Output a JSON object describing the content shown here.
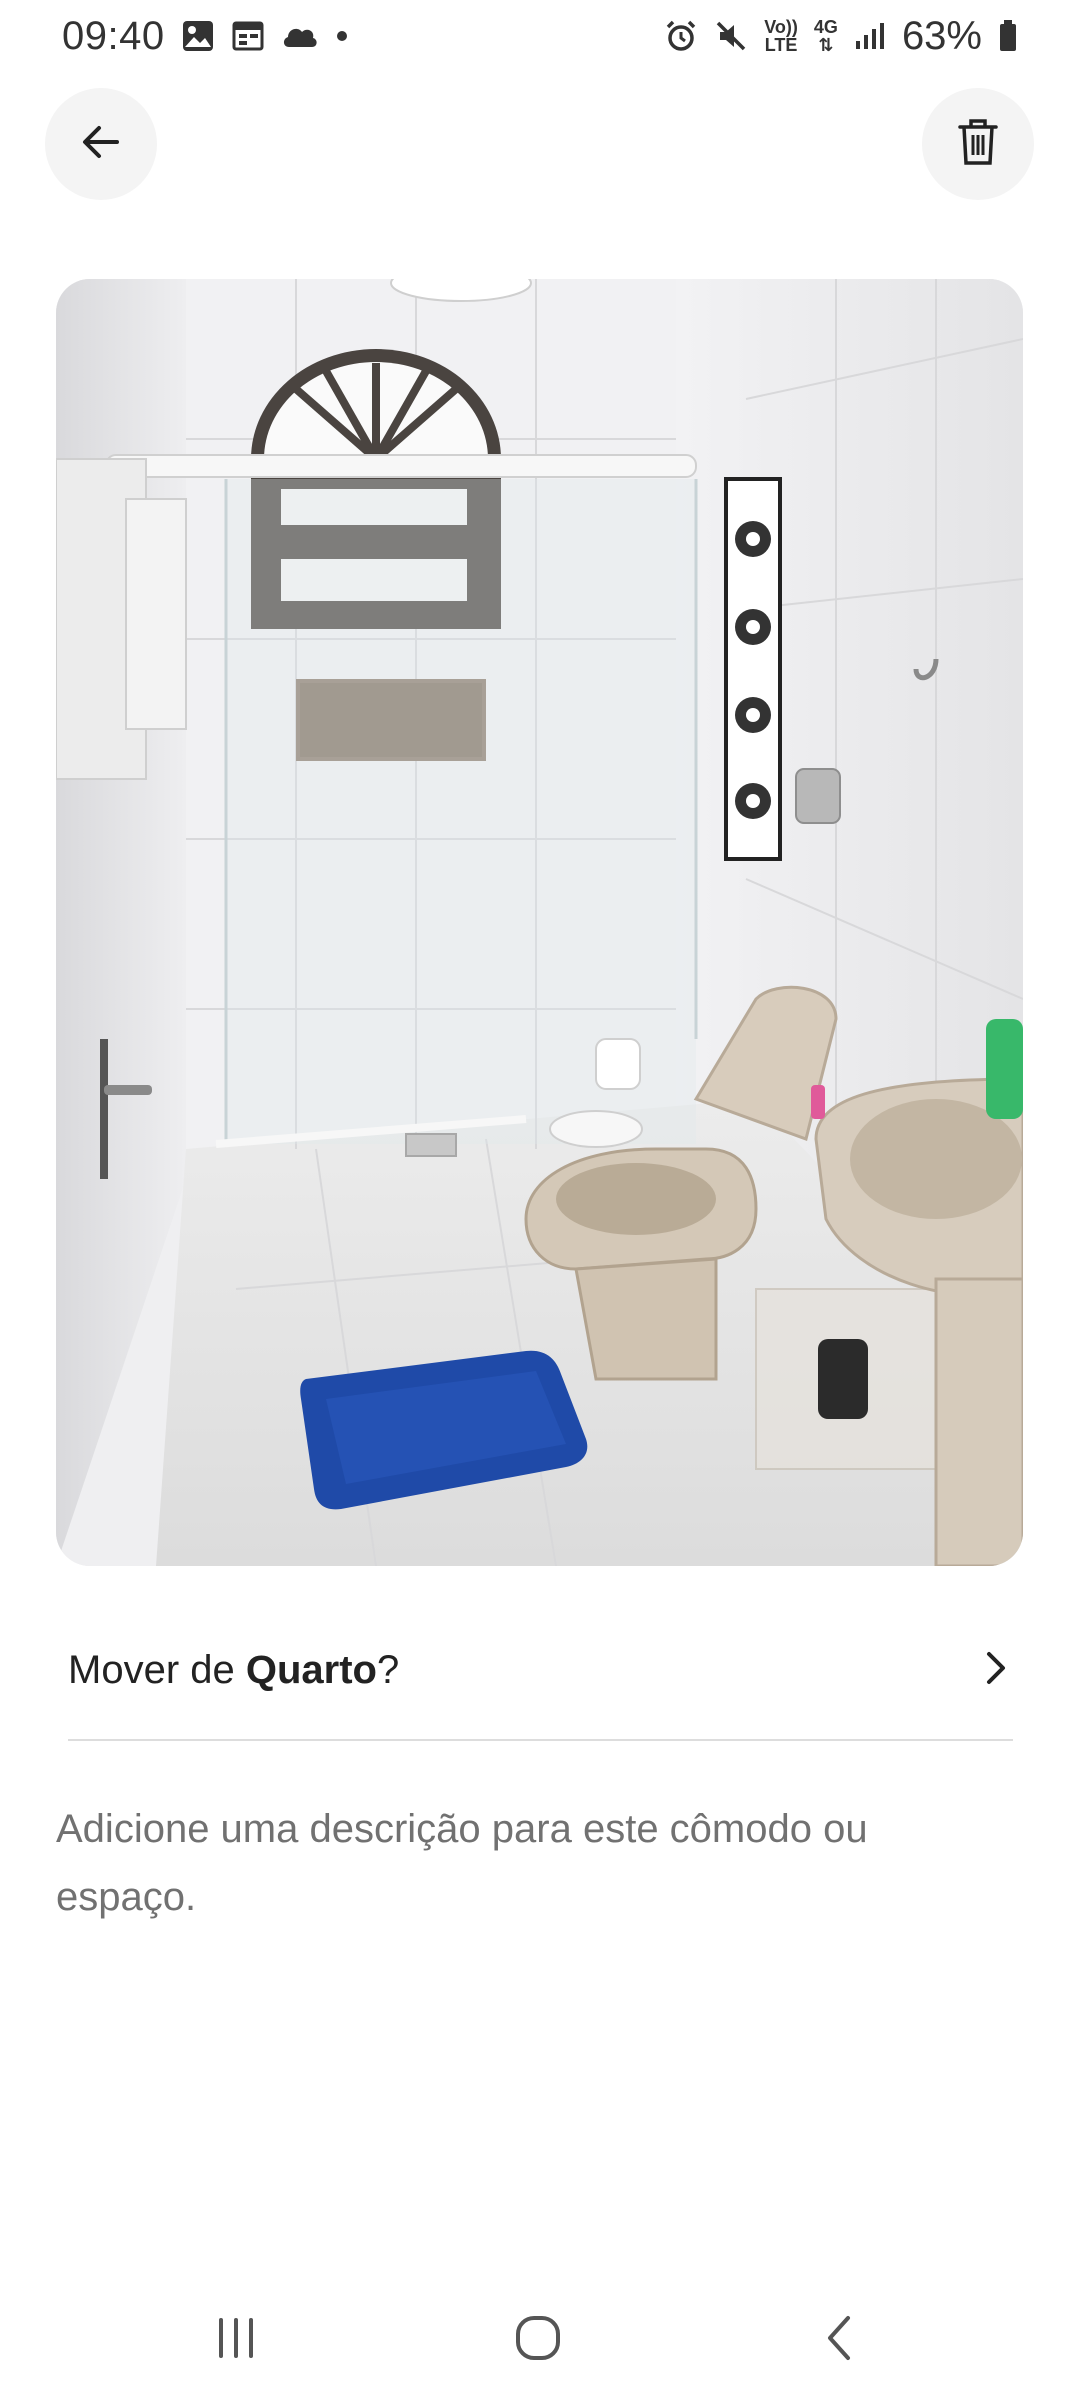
{
  "status_bar": {
    "time": "09:40",
    "left_icons": [
      "gallery-icon",
      "calendar-icon",
      "cloud-icon",
      "dot-icon"
    ],
    "right_icons": [
      "alarm-icon",
      "mute-icon",
      "volte-icon",
      "4g-icon",
      "signal-icon"
    ],
    "volte_label_top": "Vo))",
    "volte_label_bottom": "LTE",
    "network_label": "4G",
    "battery": "63%"
  },
  "header": {
    "back_icon": "arrow-left-icon",
    "delete_icon": "trash-icon"
  },
  "photo": {
    "subject": "bathroom"
  },
  "move_row": {
    "prefix": "Mover de ",
    "room": "Quarto",
    "suffix": "?",
    "icon": "chevron-right-icon"
  },
  "description": {
    "placeholder": "Adicione uma descrição para este cômodo ou espaço."
  },
  "nav_bar": {
    "recent_icon": "recent-apps-icon",
    "home_icon": "home-icon",
    "back_icon": "back-icon"
  },
  "colors": {
    "text_primary": "#222222",
    "text_secondary": "#717171",
    "button_bg": "#f4f4f4",
    "divider": "#dddddd",
    "rug_blue": "#1f4aa8"
  }
}
